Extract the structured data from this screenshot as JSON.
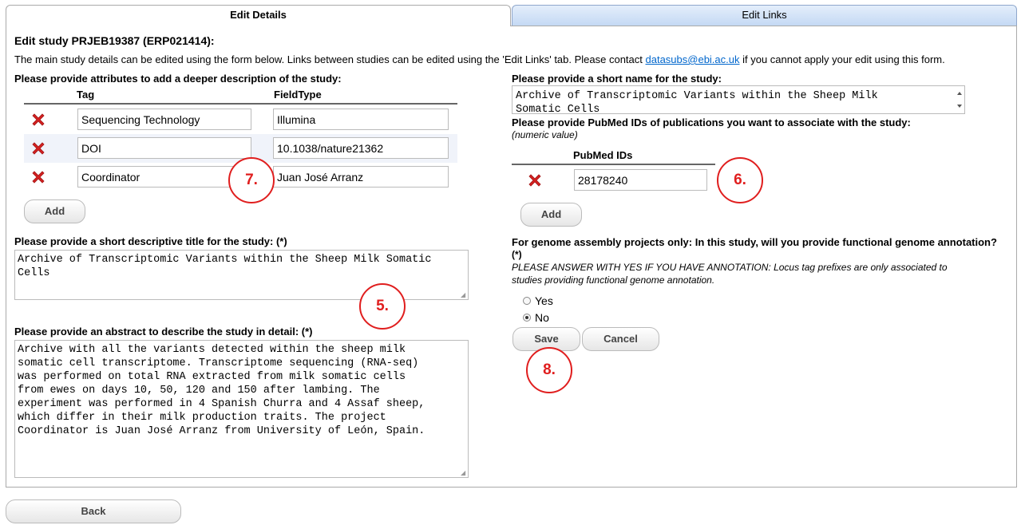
{
  "tabs": [
    {
      "label": "Edit Details"
    },
    {
      "label": "Edit Links"
    }
  ],
  "heading": "Edit study PRJEB19387 (ERP021414):",
  "intro": {
    "before": "The main study details can be edited using the form below. Links between studies can be edited using the 'Edit Links' tab. Please contact ",
    "email": "datasubs@ebi.ac.uk",
    "after": " if you cannot apply your edit using this form."
  },
  "attributes": {
    "label": "Please provide attributes to add a deeper description of the study:",
    "col_tag": "Tag",
    "col_fieldtype": "FieldType",
    "rows": [
      {
        "tag": "Sequencing Technology",
        "value": "Illumina"
      },
      {
        "tag": "DOI",
        "value": "10.1038/nature21362"
      },
      {
        "tag": "Coordinator",
        "value": "Juan José Arranz"
      }
    ],
    "add_label": "Add"
  },
  "title_field": {
    "label": "Please provide a short descriptive title for the study: (*)",
    "value": "Archive of Transcriptomic Variants within the Sheep Milk Somatic\nCells"
  },
  "abstract_field": {
    "label": "Please provide an abstract to describe the study in detail: (*)",
    "value": "Archive with all the variants detected within the sheep milk\nsomatic cell transcriptome. Transcriptome sequencing (RNA-seq)\nwas performed on total RNA extracted from milk somatic cells\nfrom ewes on days 10, 50, 120 and 150 after lambing. The\nexperiment was performed in 4 Spanish Churra and 4 Assaf sheep,\nwhich differ in their milk production traits. The project\nCoordinator is Juan José Arranz from University of León, Spain."
  },
  "short_name": {
    "label": "Please provide a short name for the study:",
    "value": "Archive of Transcriptomic Variants within the Sheep Milk\nSomatic Cells"
  },
  "pubmed": {
    "label": "Please provide PubMed IDs of publications you want to associate with the study:",
    "hint": "(numeric value)",
    "col": "PubMed IDs",
    "ids": [
      "28178240"
    ],
    "add_label": "Add"
  },
  "annotation": {
    "question": "For genome assembly projects only: In this study, will you provide functional genome annotation?",
    "required": "(*)",
    "note_line1": "PLEASE ANSWER WITH YES IF YOU HAVE ANNOTATION: Locus tag prefixes are only associated to",
    "note_line2": "studies providing functional genome annotation.",
    "options": [
      "Yes",
      "No"
    ],
    "selected": "No"
  },
  "actions": {
    "save": "Save",
    "cancel": "Cancel",
    "back": "Back"
  },
  "callouts": [
    "5.",
    "6.",
    "7.",
    "8."
  ],
  "colors": {
    "delete": "#d42020",
    "callout": "#e01e1e",
    "link": "#0066cc"
  },
  "icons": {
    "delete": "red-x-icon",
    "resize": "resize-grip-icon"
  }
}
